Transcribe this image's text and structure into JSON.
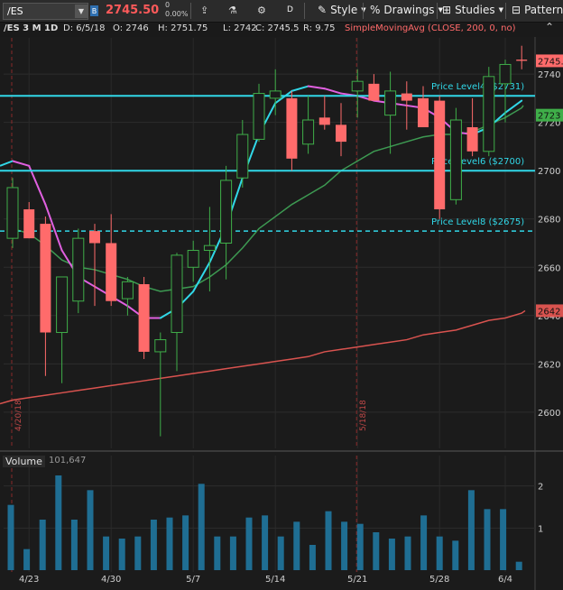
{
  "toolbar": {
    "symbol": "/ES",
    "badge": "B",
    "last_price": "2745.50",
    "net_change": "0",
    "pct_change": "0.00%",
    "interval_button": "D",
    "style_label": "Style",
    "drawings_label": "Drawings",
    "studies_label": "Studies",
    "patterns_label": "Patterns"
  },
  "info": {
    "title": "/ES 3 M 1D",
    "date": "D: 6/5/18",
    "open": "O: 2746",
    "high": "H: 2751.75",
    "low": "L: 2742",
    "close": "C: 2745.5",
    "range": "R: 9.75",
    "study": "SimpleMovingAvg (CLOSE, 200, 0, no)"
  },
  "colors": {
    "up": "#3fae49",
    "down": "#ff6b6b",
    "cyan": "#31d8e8",
    "magenta": "#e060e0",
    "green_ma": "#3d9a52",
    "sma200": "#d9534f",
    "volume": "#1f6e93"
  },
  "chart_data": {
    "type": "candlestick",
    "ylim": [
      2585,
      2755
    ],
    "y_ticks": [
      2600,
      2620,
      2640,
      2660,
      2680,
      2700,
      2720,
      2740
    ],
    "x_tick_labels": [
      "4/23",
      "4/30",
      "5/7",
      "5/14",
      "5/21",
      "5/28",
      "6/4"
    ],
    "x_tick_index": [
      1,
      6,
      11,
      16,
      21,
      26,
      30
    ],
    "month_markers": [
      {
        "index": 0,
        "label": "4/20/18"
      },
      {
        "index": 21,
        "label": "5/18/18"
      }
    ],
    "candles": [
      {
        "o": 2672,
        "h": 2697,
        "l": 2668,
        "c": 2693
      },
      {
        "o": 2684,
        "h": 2687,
        "l": 2672,
        "c": 2672
      },
      {
        "o": 2678,
        "h": 2681,
        "l": 2615,
        "c": 2633
      },
      {
        "o": 2633,
        "h": 2652,
        "l": 2612,
        "c": 2656
      },
      {
        "o": 2646,
        "h": 2676,
        "l": 2641,
        "c": 2672
      },
      {
        "o": 2675,
        "h": 2678,
        "l": 2644,
        "c": 2670
      },
      {
        "o": 2670,
        "h": 2682,
        "l": 2644,
        "c": 2646
      },
      {
        "o": 2647,
        "h": 2656,
        "l": 2640,
        "c": 2654
      },
      {
        "o": 2653,
        "h": 2656,
        "l": 2622,
        "c": 2625
      },
      {
        "o": 2625,
        "h": 2633,
        "l": 2590,
        "c": 2630
      },
      {
        "o": 2633,
        "h": 2666,
        "l": 2617,
        "c": 2665
      },
      {
        "o": 2660,
        "h": 2671,
        "l": 2654,
        "c": 2667
      },
      {
        "o": 2667,
        "h": 2685,
        "l": 2650,
        "c": 2669
      },
      {
        "o": 2670,
        "h": 2702,
        "l": 2655,
        "c": 2696
      },
      {
        "o": 2697,
        "h": 2721,
        "l": 2693,
        "c": 2715
      },
      {
        "o": 2713,
        "h": 2736,
        "l": 2712,
        "c": 2732
      },
      {
        "o": 2730,
        "h": 2742,
        "l": 2723,
        "c": 2733
      },
      {
        "o": 2730,
        "h": 2733,
        "l": 2700,
        "c": 2705
      },
      {
        "o": 2711,
        "h": 2731,
        "l": 2707,
        "c": 2721
      },
      {
        "o": 2722,
        "h": 2731,
        "l": 2717,
        "c": 2719
      },
      {
        "o": 2719,
        "h": 2728,
        "l": 2706,
        "c": 2712
      },
      {
        "o": 2733,
        "h": 2742,
        "l": 2722,
        "c": 2737
      },
      {
        "o": 2736,
        "h": 2740,
        "l": 2729,
        "c": 2729
      },
      {
        "o": 2723,
        "h": 2741,
        "l": 2707,
        "c": 2733
      },
      {
        "o": 2732,
        "h": 2737,
        "l": 2717,
        "c": 2729
      },
      {
        "o": 2730,
        "h": 2735,
        "l": 2718,
        "c": 2718
      },
      {
        "o": 2729,
        "h": 2731,
        "l": 2680,
        "c": 2684
      },
      {
        "o": 2688,
        "h": 2726,
        "l": 2686,
        "c": 2721
      },
      {
        "o": 2718,
        "h": 2730,
        "l": 2706,
        "c": 2708
      },
      {
        "o": 2708,
        "h": 2743,
        "l": 2706,
        "c": 2739
      },
      {
        "o": 2736,
        "h": 2746,
        "l": 2720,
        "c": 2744
      },
      {
        "o": 2746,
        "h": 2751.75,
        "l": 2742,
        "c": 2745.5
      }
    ],
    "ma_fast": [
      2704,
      2702,
      2686,
      2667,
      2656,
      2652,
      2648,
      2644,
      2639,
      2639,
      2643,
      2650,
      2662,
      2677,
      2697,
      2715,
      2728,
      2733,
      2735,
      2734,
      2732,
      2731,
      2729,
      2728,
      2727,
      2726,
      2722,
      2716,
      2715,
      2718,
      2724,
      2729
    ],
    "ma_slow": [
      2676,
      2674,
      2669,
      2663,
      2660,
      2659,
      2657,
      2655,
      2652,
      2650,
      2651,
      2652,
      2656,
      2661,
      2668,
      2676,
      2681,
      2686,
      2690,
      2694,
      2700,
      2704,
      2708,
      2710,
      2712,
      2714,
      2715,
      2715,
      2716,
      2719,
      2722,
      2726
    ],
    "sma200": [
      2605,
      2606,
      2607,
      2608,
      2609,
      2610,
      2611,
      2612,
      2613,
      2614,
      2615,
      2616,
      2617,
      2618,
      2619,
      2620,
      2621,
      2622,
      2623,
      2625,
      2626,
      2627,
      2628,
      2629,
      2630,
      2632,
      2633,
      2634,
      2636,
      2638,
      2639,
      2641
    ],
    "levels": [
      {
        "label": "Price Level4 ($2731)",
        "value": 2731,
        "style": "solid"
      },
      {
        "label": "Price Level6 ($2700)",
        "value": 2700,
        "style": "solid"
      },
      {
        "label": "Price Level8 ($2675)",
        "value": 2675,
        "style": "dashed"
      }
    ],
    "price_tags": [
      {
        "text": "2745.",
        "value": 2745.5,
        "color": "#ff6b6b"
      },
      {
        "text": "2723",
        "value": 2723,
        "color": "#3fae49"
      },
      {
        "text": "2642",
        "value": 2642,
        "color": "#d9534f"
      }
    ],
    "volume": {
      "title": "Volume",
      "value": "101,647",
      "ylim": [
        0,
        2.4
      ],
      "y_ticks": [
        1,
        2
      ],
      "values": [
        1.55,
        0.5,
        1.2,
        2.25,
        1.2,
        1.9,
        0.8,
        0.75,
        0.8,
        1.2,
        1.25,
        1.3,
        2.05,
        0.8,
        0.8,
        1.25,
        1.3,
        0.8,
        1.15,
        0.6,
        1.4,
        1.15,
        1.1,
        0.9,
        0.75,
        0.8,
        1.3,
        0.8,
        0.7,
        1.9,
        1.45,
        1.45,
        0.2
      ]
    }
  }
}
